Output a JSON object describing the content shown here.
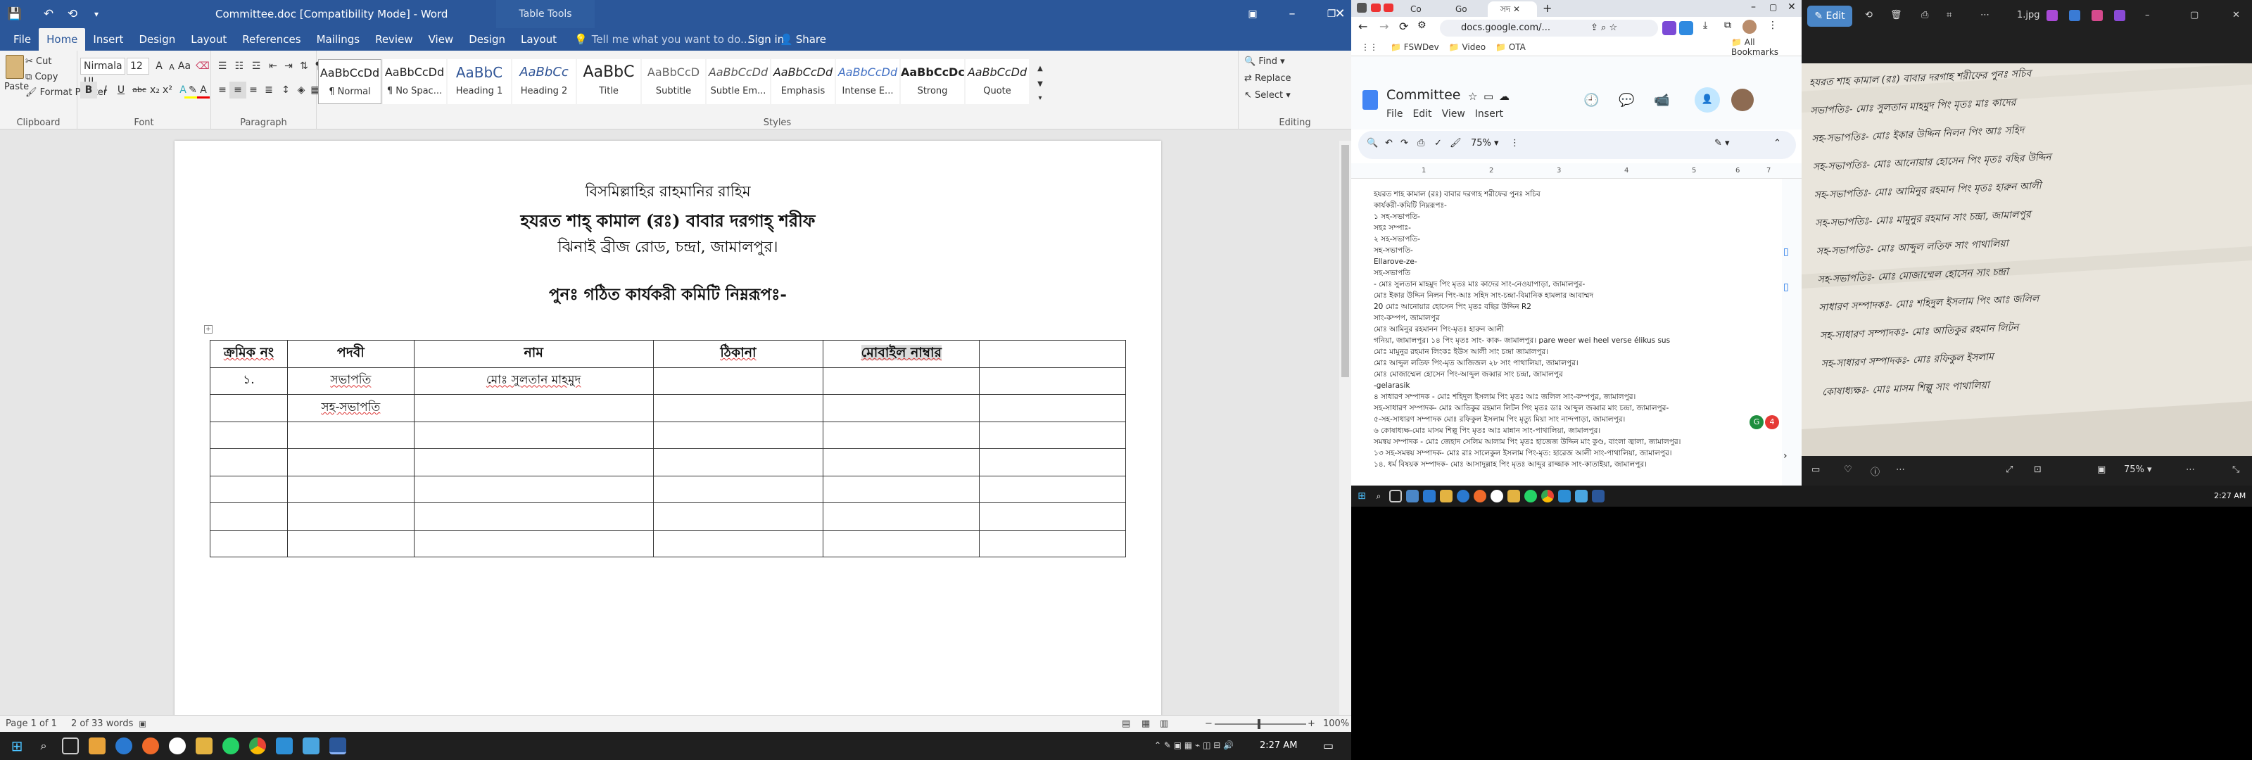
{
  "word": {
    "quick_access": {
      "save": "💾",
      "undo": "↶",
      "redo": "⟲",
      "more": "▾"
    },
    "title": "Committee.doc [Compatibility Mode] - Word",
    "table_tools": "Table Tools",
    "tabs": [
      "File",
      "Home",
      "Insert",
      "Design",
      "Layout",
      "References",
      "Mailings",
      "Review",
      "View",
      "Design",
      "Layout"
    ],
    "tell_me": "Tell me what you want to do...",
    "sign_in": "Sign in",
    "share": "Share",
    "clipboard": {
      "paste": "Paste",
      "cut": "Cut",
      "copy": "Copy",
      "format_painter": "Format Painter",
      "label": "Clipboard"
    },
    "font": {
      "name": "Nirmala UI",
      "size": "12",
      "label": "Font",
      "bold": "B",
      "italic": "I",
      "underline": "U",
      "strike": "abc",
      "sub": "x₂",
      "sup": "x²",
      "grow": "A",
      "shrink": "A",
      "case": "Aa"
    },
    "paragraph_label": "Paragraph",
    "styles": [
      {
        "preview": "AaBbCcDd",
        "name": "¶ Normal"
      },
      {
        "preview": "AaBbCcDd",
        "name": "¶ No Spac..."
      },
      {
        "preview": "AaBbC",
        "name": "Heading 1"
      },
      {
        "preview": "AaBbCc",
        "name": "Heading 2"
      },
      {
        "preview": "AaBbC",
        "name": "Title"
      },
      {
        "preview": "AaBbCcD",
        "name": "Subtitle"
      },
      {
        "preview": "AaBbCcDd",
        "name": "Subtle Em..."
      },
      {
        "preview": "AaBbCcDd",
        "name": "Emphasis"
      },
      {
        "preview": "AaBbCcDd",
        "name": "Intense E..."
      },
      {
        "preview": "AaBbCcDc",
        "name": "Strong"
      },
      {
        "preview": "AaBbCcDd",
        "name": "Quote"
      }
    ],
    "styles_label": "Styles",
    "editing": {
      "find": "Find",
      "replace": "Replace",
      "select": "Select",
      "label": "Editing"
    },
    "doc": {
      "line1": "বিসমিল্লাহির রাহমানির রাহিম",
      "line2": "হযরত শাহ্‌ কামাল (রঃ) বাবার দরগাহ্‌ শরীফ",
      "line3": "ঝিনাই ব্রীজ রোড, চন্দ্রা, জামালপুর।",
      "line4": "পুনঃ গঠিত কার্যকরী কমিটি নিম্নরূপঃ-",
      "table": {
        "headers": [
          "ক্রমিক নং",
          "পদবী",
          "নাম",
          "ঠিকানা",
          "মোবাইল নাম্বার",
          ""
        ],
        "rows": [
          [
            "১.",
            "সভাপতি",
            "মোঃ সুলতান মাহমুদ",
            "",
            "",
            ""
          ],
          [
            "",
            "সহ-সভাপতি",
            "",
            "",
            "",
            ""
          ],
          [
            "",
            "",
            "",
            "",
            "",
            ""
          ],
          [
            "",
            "",
            "",
            "",
            "",
            ""
          ],
          [
            "",
            "",
            "",
            "",
            "",
            ""
          ],
          [
            "",
            "",
            "",
            "",
            "",
            ""
          ],
          [
            "",
            "",
            "",
            "",
            "",
            ""
          ]
        ]
      }
    },
    "status": {
      "page": "Page 1 of 1",
      "words": "2 of 33 words",
      "zoom": "100%"
    }
  },
  "win_taskbar": {
    "time": "2:27 AM"
  },
  "chrome": {
    "tabs": [
      "Co",
      "Go",
      "সদ"
    ],
    "url": "docs.google.com/...",
    "bookmarks": [
      "FSWDev",
      "Video",
      "OTA"
    ],
    "all_bookmarks": "All Bookmarks",
    "gdoc": {
      "title": "Committee",
      "menus": [
        "File",
        "Edit",
        "View",
        "Insert"
      ],
      "zoom": "75%",
      "ruler": [
        "1",
        "2",
        "3",
        "4",
        "5",
        "6",
        "7"
      ],
      "badge": "4",
      "lines": [
        "হযরত শাহ কামাল (রঃ) বাবার দরগাহ শরীফের পুনঃ সচিব",
        "কার্যকরী-কমিটি নিম্নরূপঃ-",
        "১ সহ-সভাপতি-",
        "সহঃ সম্পাঃ-",
        "২ সহ-সভাপতি-",
        "সহ-সভাপতি-",
        "Ellarove-ze-",
        "সহ-সভাপতি",
        "- মোঃ সুলতান মাহমুদ পিং মৃতঃ মাঃ কাদের সাং-নেওয়াপাড়া, জামালপুর-",
        "মোঃ ইকার উদ্দিন নিলন পিং-আঃ সহিদ সাং-চন্দ্রা-বিমানিক হামলার আবাম্মদ",
        "20 মোঃ আনোয়ার হোসেন পিং মৃতঃ বছির উদ্দিন R2",
        "সাং-কম্পপ, জামালপুর",
        "মোঃ আমিনুর রহমানন পিং-মৃতঃ হারুন আলী",
        "গনিয়া, জামালপুর। ১৪ পিং মৃতঃ সাং- কাক- জামালপুর। pare weer wei heel verse élikus sus",
        "মোঃ মামুনুর রহমান লিংকঃ ইউস আলী সাং চন্দ্রা জামালপুর।",
        "মোঃ আব্দুল লতিফ পিং-মৃত আজিজল ২৮ সাং পাথালিয়া, জামালপুর।",
        "মোঃ মোজাম্মেল হোসেন পিং-আব্দুল জব্বার সাং চন্দ্রা, জামালপুর",
        "-gelarasik",
        "৪ সাধারণ সম্পাদক - মোঃ শহিদুল ইসলাম পিং মৃতঃ আঃ জলিল সাং-কম্পপুর, জামালপুর।",
        "সহ-সাধারণ সম্পাদক- মোঃ আতিকুর রহমান লিটন পিং মৃতঃ ডাঃ আব্দুল জব্বার মাং চন্দ্রা, জামালপুর-",
        "৫-সহ-সাধারণ সম্পাদক মোঃ রফিকুল ইসলাম পিং মৃত্যু মিয়া সাং নান্দপাড়া, জামালপুর।",
        "৬ কোষাধ্যক্ষ-মোঃ মাসম শিল্পু পিং মৃতঃ আঃ মান্নান সাং-পাথালিয়া, জামালপুর।",
        "সমন্বয় সম্পাদক - মোঃ জেহাদ সেলিম আলাম পিং মৃতঃ হাজেজ উদ্দিন মাং কুণ্ড, বাংলা জ্বালা, জামালপুর।",
        "১৩ সহ-সমন্বয় সম্পাদক- মোঃ রাঃ সালেকুল ইসলাম পিং-মৃত: হারেজ আলী সাং-পাথালিয়া, জামালপুর।",
        "১৪. ধর্ম বিষয়ক সম্পাদক- মোঃ আসাদুল্লাহ পিং মৃতঃ আব্দুর রাজ্জাক সাং-কাতাইয়া, জামালপুর।"
      ]
    }
  },
  "viewer": {
    "edit": "Edit",
    "file": "1.jpg",
    "zoom": "75%",
    "handwriting": [
      "হযরত শাহ কামাল (রঃ) বাবার দরগাহ শরীফের পুনঃ সচিব",
      "সভাপতিঃ-   মোঃ সুলতান মাহমুদ পিং মৃতঃ মাঃ কাদের",
      "সহ-সভাপতিঃ-   মোঃ ইকার উদ্দিন নিলন পিং আঃ সহিদ",
      "সহ-সভাপতিঃ-   মোঃ আনোয়ার হোসেন পিং মৃতঃ বছির উদ্দিন",
      "সহ-সভাপতিঃ-   মোঃ আমিনুর রহমান পিং মৃতঃ হারুন আলী",
      "সহ-সভাপতিঃ-   মোঃ মামুনুর রহমান সাং চন্দ্রা, জামালপুর",
      "সহ-সভাপতিঃ-   মোঃ আব্দুল লতিফ সাং পাথালিয়া",
      "সহ-সভাপতিঃ-   মোঃ মোজাম্মেল হোসেন সাং চন্দ্রা",
      "সাধারণ সম্পাদকঃ-   মোঃ শহিদুল ইসলাম পিং আঃ জলিল",
      "সহ-সাধারণ সম্পাদকঃ-   মোঃ আতিকুর রহমান লিটন",
      "সহ-সাধারণ সম্পাদকঃ-   মোঃ রফিকুল ইসলাম",
      "কোষাধ্যক্ষঃ-   মোঃ মাসম শিল্পু সাং পাথালিয়া"
    ]
  },
  "right_taskbar": {
    "time": "2:27 AM"
  }
}
